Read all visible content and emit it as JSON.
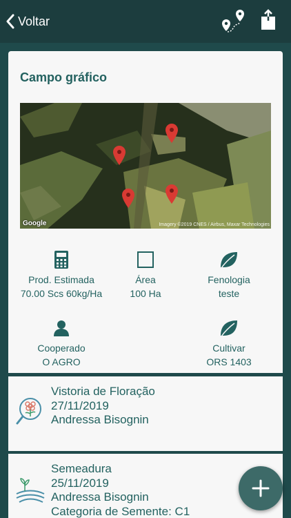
{
  "header": {
    "back_label": "Voltar",
    "icons": [
      "chevron-left-icon",
      "route-pins-icon",
      "share-icon"
    ]
  },
  "campo": {
    "title": "Campo gráfico",
    "map": {
      "attribution_left": "Google",
      "attribution_right": "Imagery ©2019 CNES / Airbus, Maxar Technologies"
    },
    "stats": [
      {
        "label": "Prod. Estimada",
        "value": "70.00 Scs 60kg/Ha",
        "icon": "calculator-icon"
      },
      {
        "label": "Área",
        "value": "100 Ha",
        "icon": "square-icon"
      },
      {
        "label": "Fenologia",
        "value": "teste",
        "icon": "leaf-icon"
      },
      {
        "label": "Cooperado",
        "value": "O AGRO",
        "icon": "person-icon"
      },
      {
        "label": "Cultivar",
        "value": "ORS 1403",
        "icon": "leaf-icon"
      }
    ]
  },
  "events": [
    {
      "lines": [
        "Vistoria de Floração",
        "27/11/2019",
        "Andressa Bisognin"
      ],
      "icon": "magnifier-flower-icon"
    },
    {
      "lines": [
        "Semeadura",
        "25/11/2019",
        "Andressa Bisognin",
        "Categoria de Semente: C1"
      ],
      "icon": "sprout-field-icon"
    }
  ],
  "fab": {
    "label": "+"
  },
  "colors": {
    "header": "#1c3d3e",
    "background": "#1f4a4b",
    "accent": "#236260",
    "pin": "#d93a33"
  }
}
